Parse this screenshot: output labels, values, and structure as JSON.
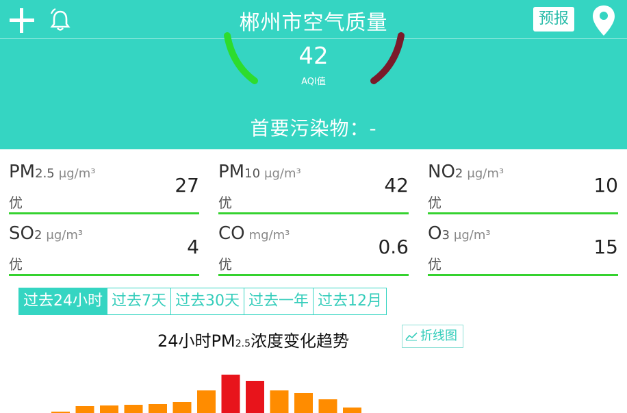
{
  "header": {
    "title": "郴州市空气质量",
    "forecast_label": "预报"
  },
  "aqi": {
    "value": "42",
    "label": "AQI值",
    "primary_pollutant": "首要污染物：-"
  },
  "pollutants": [
    {
      "name": "PM",
      "sub": "2.5",
      "unit": "μg/m³",
      "grade": "优",
      "value": "27"
    },
    {
      "name": "PM",
      "sub": "10",
      "unit": "μg/m³",
      "grade": "优",
      "value": "42"
    },
    {
      "name": "NO",
      "sub": "2",
      "unit": "μg/m³",
      "grade": "优",
      "value": "10"
    },
    {
      "name": "SO",
      "sub": "2",
      "unit": "μg/m³",
      "grade": "优",
      "value": "4"
    },
    {
      "name": "CO",
      "sub": "",
      "unit": "mg/m³",
      "grade": "优",
      "value": "0.6"
    },
    {
      "name": "O",
      "sub": "3",
      "unit": "μg/m³",
      "grade": "优",
      "value": "15"
    }
  ],
  "tabs": [
    {
      "label": "过去24小时",
      "active": true
    },
    {
      "label": "过去7天",
      "active": false
    },
    {
      "label": "过去30天",
      "active": false
    },
    {
      "label": "过去一年",
      "active": false
    },
    {
      "label": "过去12月",
      "active": false
    }
  ],
  "trend": {
    "title_prefix": "24小时PM",
    "title_sub": "2.5",
    "title_suffix": "浓度变化趋势",
    "toggle_label": "折线图"
  },
  "colors": {
    "teal": "#35d5c2",
    "good_green": "#35d22f",
    "bar_orange": "#ff8c00",
    "bar_red": "#e8141b"
  },
  "chart_data": {
    "type": "bar",
    "title": "24小时PM2.5浓度变化趋势",
    "values": [
      2,
      10,
      11,
      12,
      13,
      16,
      33,
      56,
      47,
      33,
      29,
      20,
      8
    ],
    "colors": [
      "orange",
      "orange",
      "orange",
      "orange",
      "orange",
      "orange",
      "orange",
      "red",
      "red",
      "orange",
      "orange",
      "orange",
      "orange"
    ],
    "ylim": [
      0,
      60
    ]
  }
}
